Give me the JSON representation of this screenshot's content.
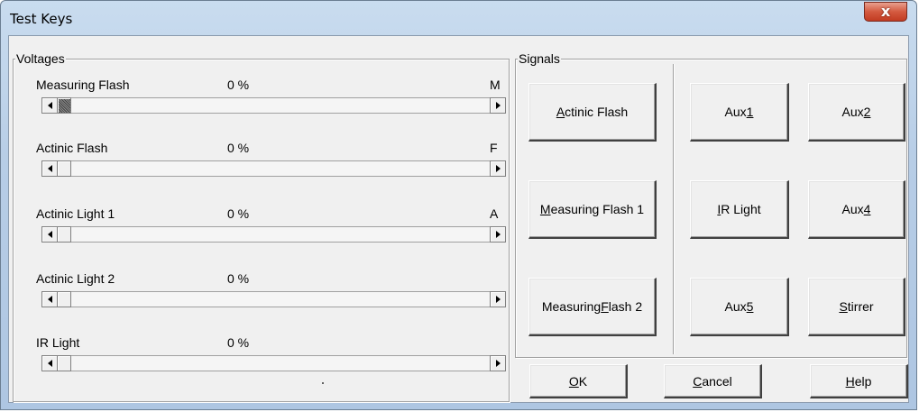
{
  "window": {
    "title": "Test Keys",
    "close_glyph": "x"
  },
  "voltages": {
    "group_label": "Voltages",
    "rows": [
      {
        "label": "Measuring Flash",
        "value": "0 %",
        "tag": "M"
      },
      {
        "label": "Actinic Flash",
        "value": "0 %",
        "tag": "F"
      },
      {
        "label": "Actinic Light 1",
        "value": "0 %",
        "tag": "A"
      },
      {
        "label": "Actinic Light 2",
        "value": "0 %",
        "tag": ""
      },
      {
        "label": "IR Light",
        "value": "0 %",
        "tag": ""
      }
    ]
  },
  "signals": {
    "group_label": "Signals",
    "buttons": [
      {
        "pre": "",
        "key": "A",
        "post": "ctinic Flash"
      },
      {
        "pre": "",
        "key": "M",
        "post": "easuring Flash 1"
      },
      {
        "pre": "Measuring ",
        "key": "F",
        "post": "lash 2"
      },
      {
        "pre": "Aux ",
        "key": "1",
        "post": ""
      },
      {
        "pre": "Aux ",
        "key": "2",
        "post": ""
      },
      {
        "pre": "",
        "key": "I",
        "post": "R Light"
      },
      {
        "pre": "Aux ",
        "key": "4",
        "post": ""
      },
      {
        "pre": "Aux ",
        "key": "5",
        "post": ""
      },
      {
        "pre": "",
        "key": "S",
        "post": "tirrer"
      }
    ]
  },
  "actions": {
    "ok": {
      "pre": "",
      "key": "O",
      "post": "K"
    },
    "cancel": {
      "pre": "",
      "key": "C",
      "post": "ancel"
    },
    "help": {
      "pre": "",
      "key": "H",
      "post": "elp"
    }
  },
  "colors": {
    "face": "#f0f0f0",
    "frame": "#b7cde6",
    "close": "#c13b22"
  }
}
